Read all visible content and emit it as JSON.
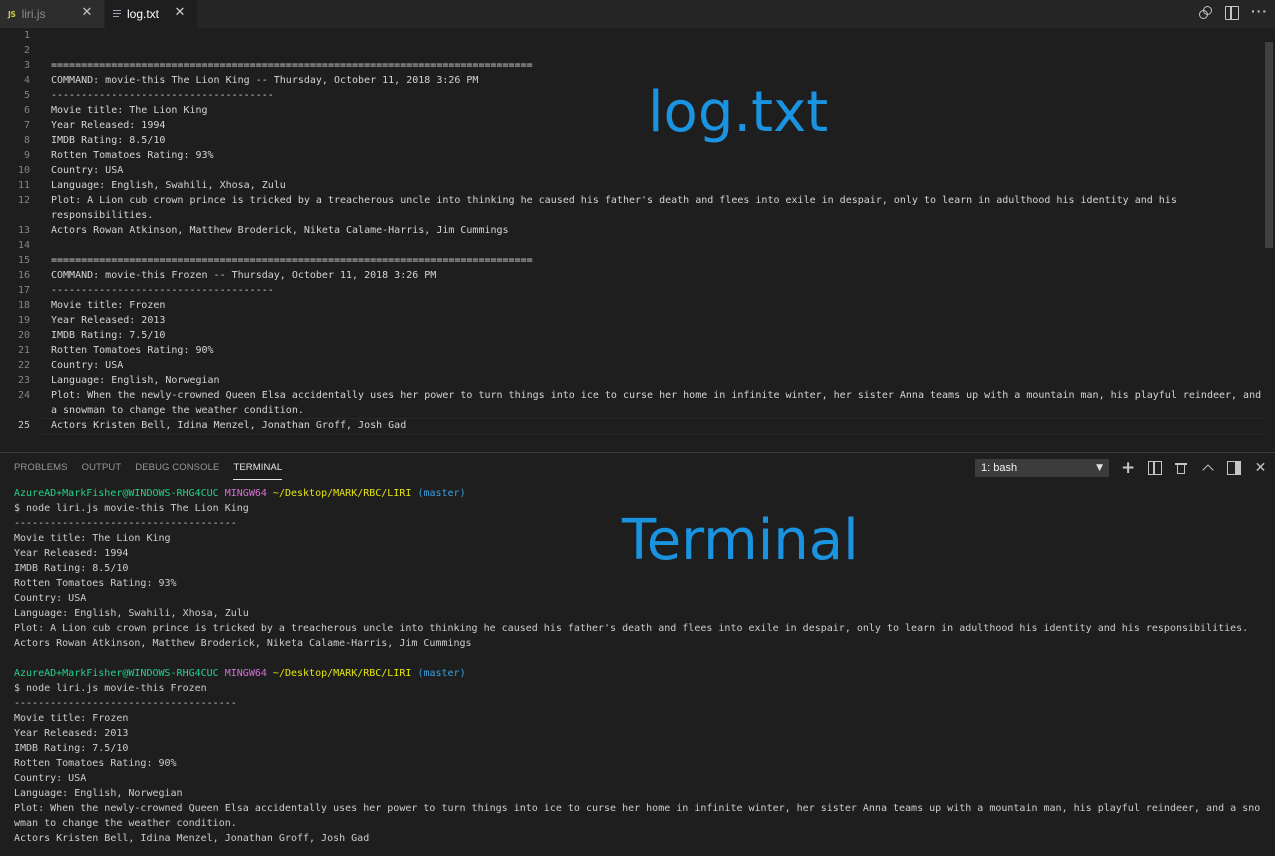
{
  "tabs": [
    {
      "icon": "js-file-icon",
      "badge": "JS",
      "label": "liri.js",
      "active": false
    },
    {
      "icon": "text-file-icon",
      "label": "log.txt",
      "active": true
    }
  ],
  "editor": {
    "overlay_label": "log.txt",
    "active_line": 25,
    "lines": [
      {
        "num": "1",
        "text": ""
      },
      {
        "num": "2",
        "text": ""
      },
      {
        "num": "3",
        "text": "================================================================================"
      },
      {
        "num": "4",
        "text": "COMMAND: movie-this The Lion King -- Thursday, October 11, 2018 3:26 PM"
      },
      {
        "num": "5",
        "text": "-------------------------------------"
      },
      {
        "num": "6",
        "text": "Movie title: The Lion King"
      },
      {
        "num": "7",
        "text": "Year Released: 1994"
      },
      {
        "num": "8",
        "text": "IMDB Rating: 8.5/10"
      },
      {
        "num": "9",
        "text": "Rotten Tomatoes Rating: 93%"
      },
      {
        "num": "10",
        "text": "Country: USA"
      },
      {
        "num": "11",
        "text": "Language: English, Swahili, Xhosa, Zulu"
      },
      {
        "num": "12",
        "text": "Plot: A Lion cub crown prince is tricked by a treacherous uncle into thinking he caused his father's death and flees into exile in despair, only to learn in adulthood his identity and his"
      },
      {
        "num": "",
        "text": "responsibilities."
      },
      {
        "num": "13",
        "text": "Actors Rowan Atkinson, Matthew Broderick, Niketa Calame-Harris, Jim Cummings"
      },
      {
        "num": "14",
        "text": ""
      },
      {
        "num": "15",
        "text": "================================================================================"
      },
      {
        "num": "16",
        "text": "COMMAND: movie-this Frozen -- Thursday, October 11, 2018 3:26 PM"
      },
      {
        "num": "17",
        "text": "-------------------------------------"
      },
      {
        "num": "18",
        "text": "Movie title: Frozen"
      },
      {
        "num": "19",
        "text": "Year Released: 2013"
      },
      {
        "num": "20",
        "text": "IMDB Rating: 7.5/10"
      },
      {
        "num": "21",
        "text": "Rotten Tomatoes Rating: 90%"
      },
      {
        "num": "22",
        "text": "Country: USA"
      },
      {
        "num": "23",
        "text": "Language: English, Norwegian"
      },
      {
        "num": "24",
        "text": "Plot: When the newly-crowned Queen Elsa accidentally uses her power to turn things into ice to curse her home in infinite winter, her sister Anna teams up with a mountain man, his playful reindeer, and"
      },
      {
        "num": "",
        "text": "a snowman to change the weather condition."
      },
      {
        "num": "25",
        "text": "Actors Kristen Bell, Idina Menzel, Jonathan Groff, Josh Gad"
      }
    ]
  },
  "panel": {
    "tabs": [
      {
        "label": "PROBLEMS",
        "active": false
      },
      {
        "label": "OUTPUT",
        "active": false
      },
      {
        "label": "DEBUG CONSOLE",
        "active": false
      },
      {
        "label": "TERMINAL",
        "active": true
      }
    ],
    "terminal_select": "1: bash",
    "overlay_label": "Terminal"
  },
  "terminal": {
    "lines": [
      {
        "type": "prompt",
        "user": "AzureAD+MarkFisher@WINDOWS-RHG4CUC",
        "env": "MINGW64",
        "path": "~/Desktop/MARK/RBC/LIRI",
        "branch": "(master)"
      },
      {
        "type": "text",
        "text": "$ node liri.js movie-this The Lion King"
      },
      {
        "type": "text",
        "text": "-------------------------------------"
      },
      {
        "type": "text",
        "text": "Movie title: The Lion King"
      },
      {
        "type": "text",
        "text": "Year Released: 1994"
      },
      {
        "type": "text",
        "text": "IMDB Rating: 8.5/10"
      },
      {
        "type": "text",
        "text": "Rotten Tomatoes Rating: 93%"
      },
      {
        "type": "text",
        "text": "Country: USA"
      },
      {
        "type": "text",
        "text": "Language: English, Swahili, Xhosa, Zulu"
      },
      {
        "type": "text",
        "text": "Plot: A Lion cub crown prince is tricked by a treacherous uncle into thinking he caused his father's death and flees into exile in despair, only to learn in adulthood his identity and his responsibilities."
      },
      {
        "type": "text",
        "text": "Actors Rowan Atkinson, Matthew Broderick, Niketa Calame-Harris, Jim Cummings"
      },
      {
        "type": "text",
        "text": ""
      },
      {
        "type": "prompt",
        "user": "AzureAD+MarkFisher@WINDOWS-RHG4CUC",
        "env": "MINGW64",
        "path": "~/Desktop/MARK/RBC/LIRI",
        "branch": "(master)"
      },
      {
        "type": "text",
        "text": "$ node liri.js movie-this Frozen"
      },
      {
        "type": "text",
        "text": "-------------------------------------"
      },
      {
        "type": "text",
        "text": "Movie title: Frozen"
      },
      {
        "type": "text",
        "text": "Year Released: 2013"
      },
      {
        "type": "text",
        "text": "IMDB Rating: 7.5/10"
      },
      {
        "type": "text",
        "text": "Rotten Tomatoes Rating: 90%"
      },
      {
        "type": "text",
        "text": "Country: USA"
      },
      {
        "type": "text",
        "text": "Language: English, Norwegian"
      },
      {
        "type": "text",
        "text": "Plot: When the newly-crowned Queen Elsa accidentally uses her power to turn things into ice to curse her home in infinite winter, her sister Anna teams up with a mountain man, his playful reindeer, and a sno"
      },
      {
        "type": "text",
        "text": "wman to change the weather condition."
      },
      {
        "type": "text",
        "text": "Actors Kristen Bell, Idina Menzel, Jonathan Groff, Josh Gad"
      }
    ]
  },
  "colors": {
    "accent": "#1a93e0",
    "prompt_user": "#23d18b",
    "prompt_env": "#d670d6",
    "prompt_path": "#e5e510",
    "prompt_branch": "#3b9edf"
  }
}
